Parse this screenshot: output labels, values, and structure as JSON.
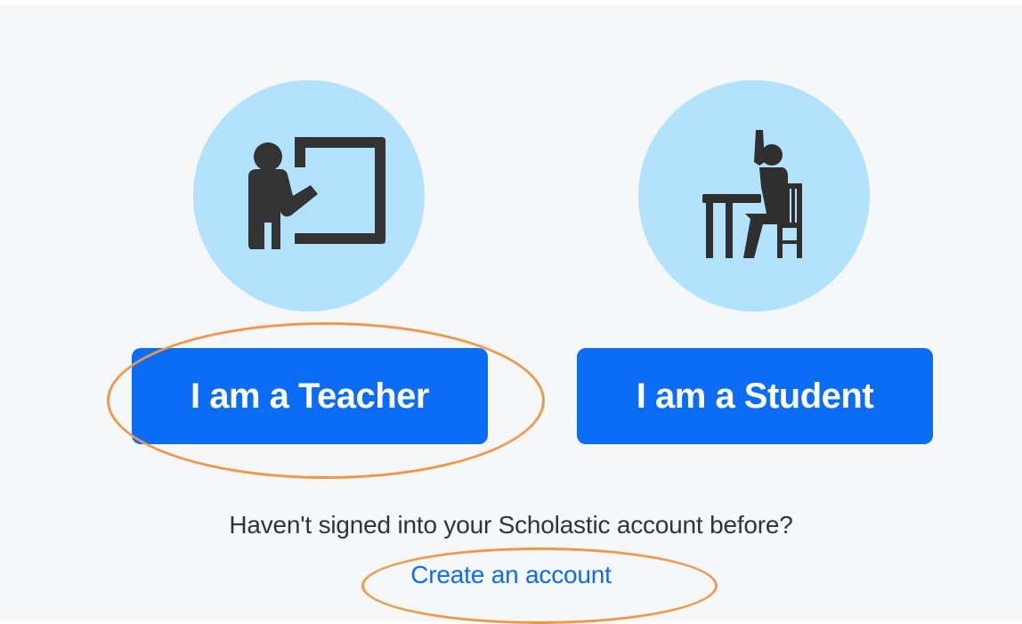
{
  "roles": {
    "teacher": {
      "button_label": "I am a Teacher",
      "icon": "teacher-at-board-icon"
    },
    "student": {
      "button_label": "I am a Student",
      "icon": "student-raising-hand-icon"
    }
  },
  "signup": {
    "prompt": "Haven't signed into your Scholastic account before?",
    "link_label": "Create an account"
  },
  "colors": {
    "background": "#f6f7f9",
    "icon_circle": "#b3e2fc",
    "icon_fill": "#333333",
    "button_bg": "#0b6cf5",
    "button_text": "#ffffff",
    "link": "#0b6cf5",
    "annotation": "#f0984a"
  }
}
